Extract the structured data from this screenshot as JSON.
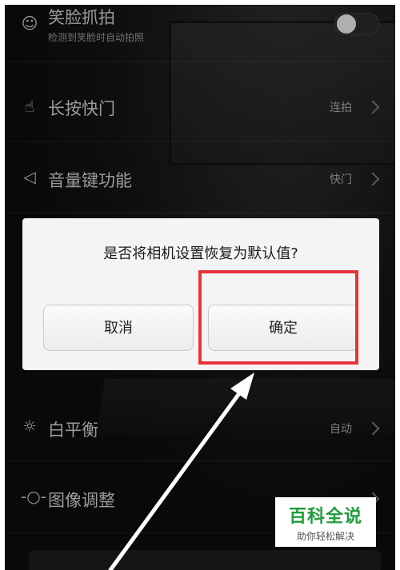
{
  "settings": {
    "items": [
      {
        "label": "笑脸抓拍",
        "sub": "检测到笑脸时自动拍照",
        "icon": "smile-icon",
        "toggle_on": false
      },
      {
        "label": "长按快门",
        "value": "连拍",
        "icon": "hand-icon"
      },
      {
        "label": "音量键功能",
        "value": "快门",
        "icon": "volume-icon"
      },
      {
        "label": "白平衡",
        "value": "自动",
        "icon": "sun-icon"
      },
      {
        "label": "图像调整",
        "value": "",
        "icon": "adjust-icon"
      }
    ]
  },
  "dialog": {
    "message": "是否将相机设置恢复为默认值?",
    "cancel_label": "取消",
    "confirm_label": "确定"
  },
  "annotation": {
    "highlight_color": "#e8333a",
    "arrow_color": "#ffffff"
  },
  "watermark": {
    "title": "百科全说",
    "subtitle": "助你轻松解决",
    "color": "#1f9c3c"
  }
}
